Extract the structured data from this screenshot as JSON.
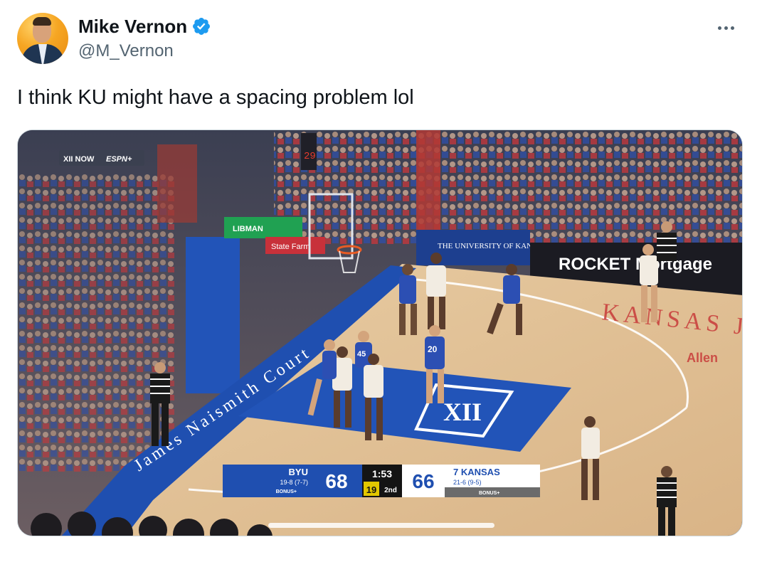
{
  "author": {
    "display_name": "Mike Vernon",
    "handle": "@M_Vernon",
    "verified": true
  },
  "tweet": {
    "text": "I think KU might have a spacing problem lol"
  },
  "icons": {
    "avatar": "avatar-photo",
    "verified": "verified-badge-icon",
    "more": "more-options-icon"
  },
  "colors": {
    "verified_blue": "#1d9bf0",
    "text_primary": "#0f1419",
    "text_secondary": "#536471",
    "court_blue": "#1f4fb0",
    "court_wood": "#e3c49b"
  },
  "media": {
    "broadcast_bug": {
      "network": "XII NOW",
      "channel": "ESPN+"
    },
    "court_text": {
      "sideline": "James Naismith Court",
      "endline": "KANSAS JAYHAWKS",
      "endline_sub": "Allen"
    },
    "signage": {
      "sponsor_1": "LIBMAN",
      "sponsor_2": "State Farm",
      "sponsor_3": "THE UNIVERSITY OF KANSAS HEALTH SYSTEM",
      "sponsor_4": "ROCKET Mortgage"
    },
    "scoreboard": {
      "away_team": "BYU",
      "away_record": "19-8 (7-7)",
      "away_bonus": "BONUS+",
      "away_score": "68",
      "clock": "1:53",
      "shot_clock": "19",
      "period": "2nd",
      "home_score": "66",
      "home_team": "7 KANSAS",
      "home_record": "21-6 (9-5)",
      "home_bonus": "BONUS+"
    }
  }
}
